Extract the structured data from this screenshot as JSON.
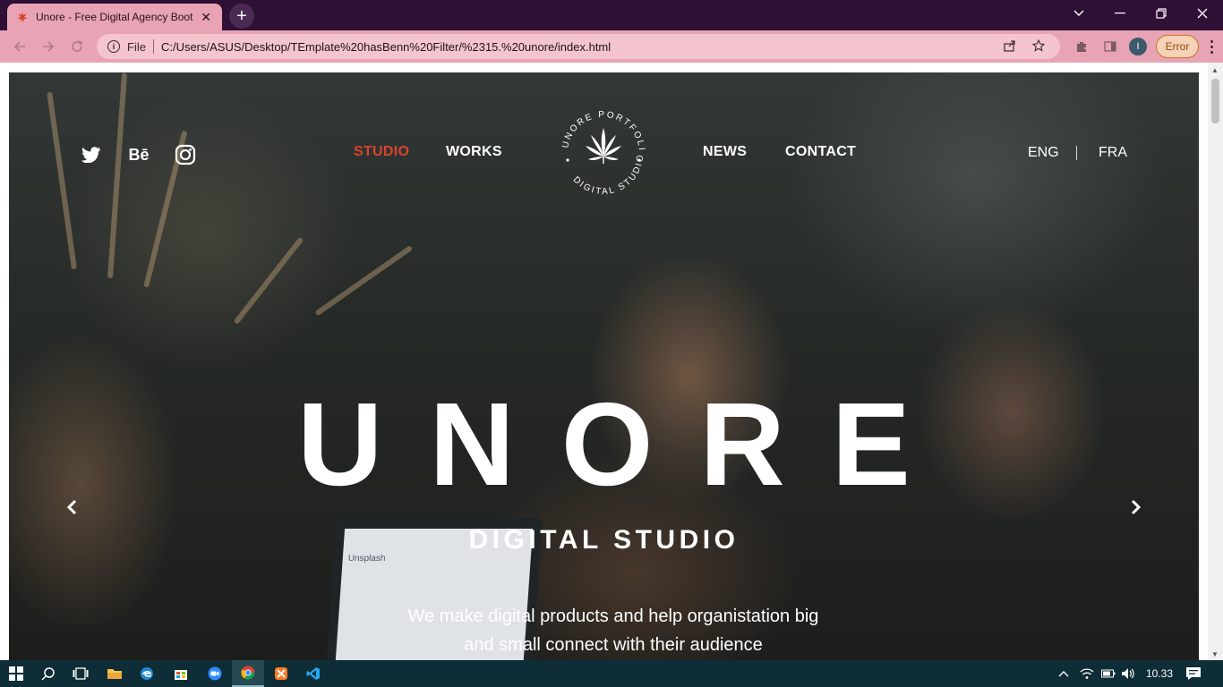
{
  "browser": {
    "tab_title": "Unore - Free Digital Agency Boot",
    "tab_close": "✕",
    "new_tab": "+",
    "scheme": "File",
    "url": "C:/Users/ASUS/Desktop/TEmplate%20hasBenn%20Filter/%2315.%20unore/index.html",
    "error_label": "Error",
    "profile_initial": "I",
    "icons": [
      "back-icon",
      "forward-icon",
      "reload-icon",
      "info-icon",
      "share-icon",
      "star-icon",
      "extensions-icon",
      "sidepanel-icon",
      "menu-icon"
    ]
  },
  "site": {
    "social": [
      "twitter-icon",
      "behance-icon",
      "instagram-icon"
    ],
    "behance_text": "Bē",
    "nav": {
      "studio": "STUDIO",
      "works": "WORKS",
      "news": "NEWS",
      "contact": "CONTACT"
    },
    "logo": {
      "ring_top": "UNORE PORTFOLIO",
      "ring_bottom": "DIGITAL STUDIO"
    },
    "lang": {
      "eng": "ENG",
      "fra": "FRA"
    },
    "hero": {
      "title": "UNORE",
      "subtitle": "DIGITAL STUDIO",
      "desc_line1": "We make digital products and help organistation big",
      "desc_line2": "and small connect with their audience"
    },
    "laptop_text": "Unsplash",
    "colors": {
      "accent": "#d9432b",
      "text": "#ffffff",
      "chrome": "#e8a4b4",
      "tabbar": "#2e0f35"
    }
  },
  "taskbar": {
    "time": "10.33",
    "apps": [
      "start-icon",
      "search-icon",
      "task-view-icon",
      "file-explorer-icon",
      "edge-icon",
      "store-icon",
      "zoom-icon",
      "chrome-icon",
      "xampp-icon",
      "vscode-icon"
    ]
  }
}
